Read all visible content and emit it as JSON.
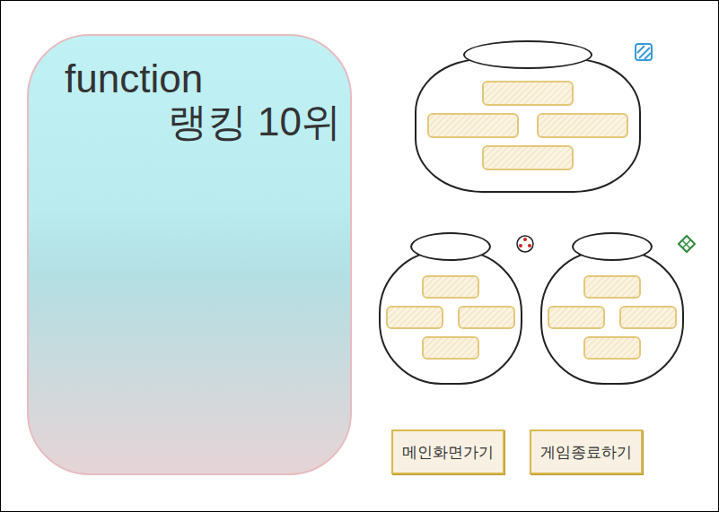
{
  "ranking_panel": {
    "title": "function",
    "subtitle": "랭킹 10위"
  },
  "bags": [
    {
      "kind": "striped-square",
      "color": "#3a9ad9",
      "slots": [
        {
          "filled": false
        },
        {
          "filled": false
        },
        {
          "filled": false
        },
        {
          "filled": false
        }
      ]
    },
    {
      "kind": "dotted-circle",
      "color": "#cc2222",
      "slots": [
        {
          "filled": false
        },
        {
          "filled": false
        },
        {
          "filled": false
        },
        {
          "filled": false
        }
      ]
    },
    {
      "kind": "diamond",
      "color": "#2e8b3e",
      "slots": [
        {
          "filled": false
        },
        {
          "filled": false
        },
        {
          "filled": false
        },
        {
          "filled": false
        }
      ]
    }
  ],
  "buttons": [
    {
      "label": "메인화면가기"
    },
    {
      "label": "게임종료하기"
    }
  ]
}
